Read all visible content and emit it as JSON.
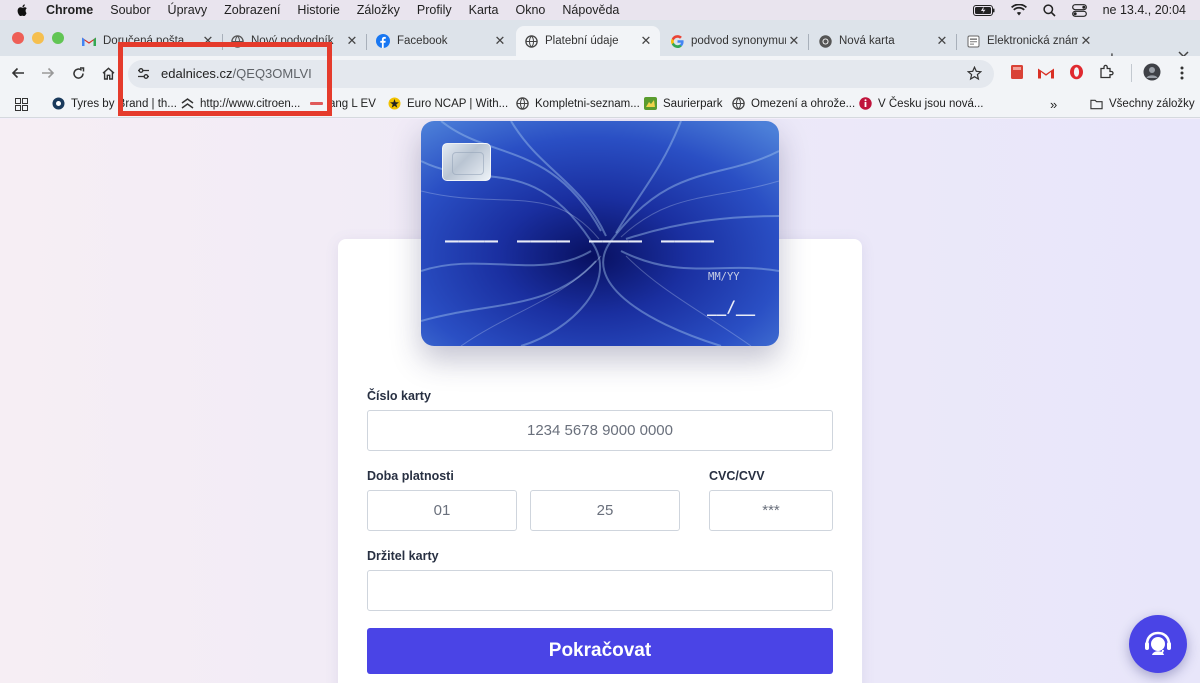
{
  "menubar": {
    "app_name": "Chrome",
    "items": [
      "Soubor",
      "Úpravy",
      "Zobrazení",
      "Historie",
      "Záložky",
      "Profily",
      "Karta",
      "Okno",
      "Nápověda"
    ],
    "datetime": "ne 13.4., 20:04"
  },
  "tabs": [
    {
      "title": "Doručená pošta",
      "icon": "gmail-icon"
    },
    {
      "title": "Nový podvodník",
      "icon": "globe-icon"
    },
    {
      "title": "Facebook",
      "icon": "facebook-icon"
    },
    {
      "title": "Platební údaje",
      "icon": "globe-icon",
      "active": true
    },
    {
      "title": "podvod synonymum",
      "icon": "google-icon"
    },
    {
      "title": "Nová karta",
      "icon": "chrome-icon"
    },
    {
      "title": "Elektronická známka",
      "icon": "document-icon"
    }
  ],
  "address_bar": {
    "host": "edalnices.cz",
    "path": "/QEQ3OMLVI"
  },
  "bookmarks": [
    {
      "title": "Tyres by Brand | th...",
      "icon": "tyres-icon"
    },
    {
      "title": "http://www.citroen...",
      "icon": "citroen-icon"
    },
    {
      "title": "ang L EV",
      "icon": "bookmark-icon"
    },
    {
      "title": "Euro NCAP | With...",
      "icon": "euroncap-icon"
    },
    {
      "title": "Kompletni-seznam...",
      "icon": "globe-icon"
    },
    {
      "title": "Saurierpark",
      "icon": "saurierpark-icon"
    },
    {
      "title": "Omezení a ohrože...",
      "icon": "globe-icon"
    },
    {
      "title": "V Česku jsou nová...",
      "icon": "innogy-icon"
    }
  ],
  "all_bookmarks_label": "Všechny záložky",
  "credit_card": {
    "number_groups": [
      "____",
      "____",
      "____",
      "____"
    ],
    "expiry_label": "MM/YY",
    "expiry_value": "__/__"
  },
  "form": {
    "card_number_label": "Číslo karty",
    "card_number_placeholder": "1234 5678 9000 0000",
    "expiry_label": "Doba platnosti",
    "expiry_month_placeholder": "01",
    "expiry_year_placeholder": "25",
    "cvc_label": "CVC/CVV",
    "cvc_placeholder": "***",
    "holder_label": "Držitel karty",
    "holder_value": "",
    "submit_label": "Pokračovat"
  },
  "colors": {
    "accent": "#4a44e6",
    "annotation": "#e53b2c"
  }
}
